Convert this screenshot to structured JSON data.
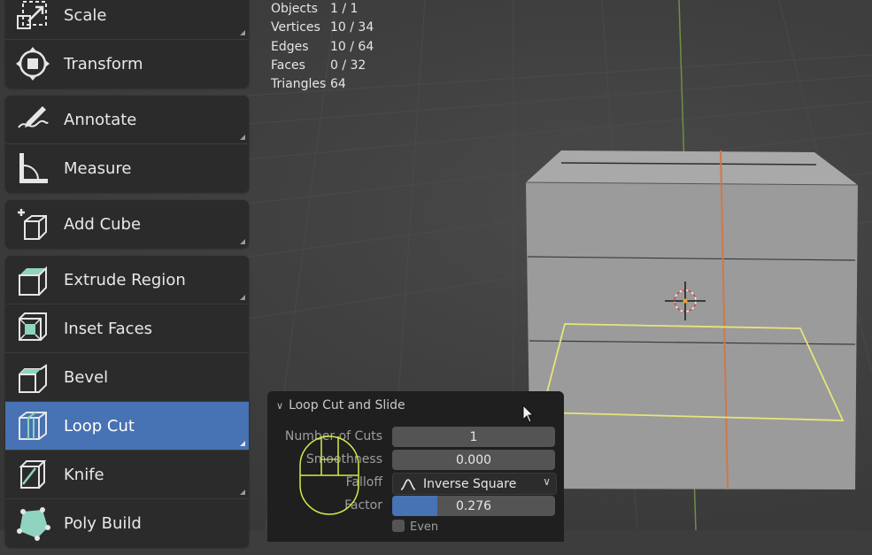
{
  "stats": [
    {
      "label": "Objects",
      "value": "1 / 1"
    },
    {
      "label": "Vertices",
      "value": "10 / 34"
    },
    {
      "label": "Edges",
      "value": "10 / 64"
    },
    {
      "label": "Faces",
      "value": "0 / 32"
    },
    {
      "label": "Triangles",
      "value": "64"
    }
  ],
  "toolbar": {
    "scale": "Scale",
    "transform": "Transform",
    "annotate": "Annotate",
    "measure": "Measure",
    "add_cube": "Add Cube",
    "extrude_region": "Extrude Region",
    "inset_faces": "Inset Faces",
    "bevel": "Bevel",
    "loop_cut": "Loop Cut",
    "knife": "Knife",
    "poly_build": "Poly Build"
  },
  "operator_panel": {
    "title": "Loop Cut and Slide",
    "number_of_cuts": {
      "label": "Number of Cuts",
      "value": "1"
    },
    "smoothness": {
      "label": "Smoothness",
      "value": "0.000"
    },
    "falloff": {
      "label": "Falloff",
      "value": "Inverse Square"
    },
    "factor": {
      "label": "Factor",
      "value": "0.276",
      "fraction": 0.276
    },
    "even": {
      "label": "Even",
      "checked": false
    }
  },
  "colors": {
    "active_tool": "#4772b3",
    "selection": "#e8e87a",
    "x_axis": "#c56a3a",
    "y_axis": "#7ea544"
  },
  "icons": {
    "scale": "scale-icon",
    "transform": "transform-icon",
    "annotate": "annotate-icon",
    "measure": "measure-icon",
    "add_cube": "add-cube-icon",
    "extrude_region": "extrude-region-icon",
    "inset_faces": "inset-faces-icon",
    "bevel": "bevel-icon",
    "loop_cut": "loop-cut-icon",
    "knife": "knife-icon",
    "poly_build": "poly-build-icon"
  }
}
